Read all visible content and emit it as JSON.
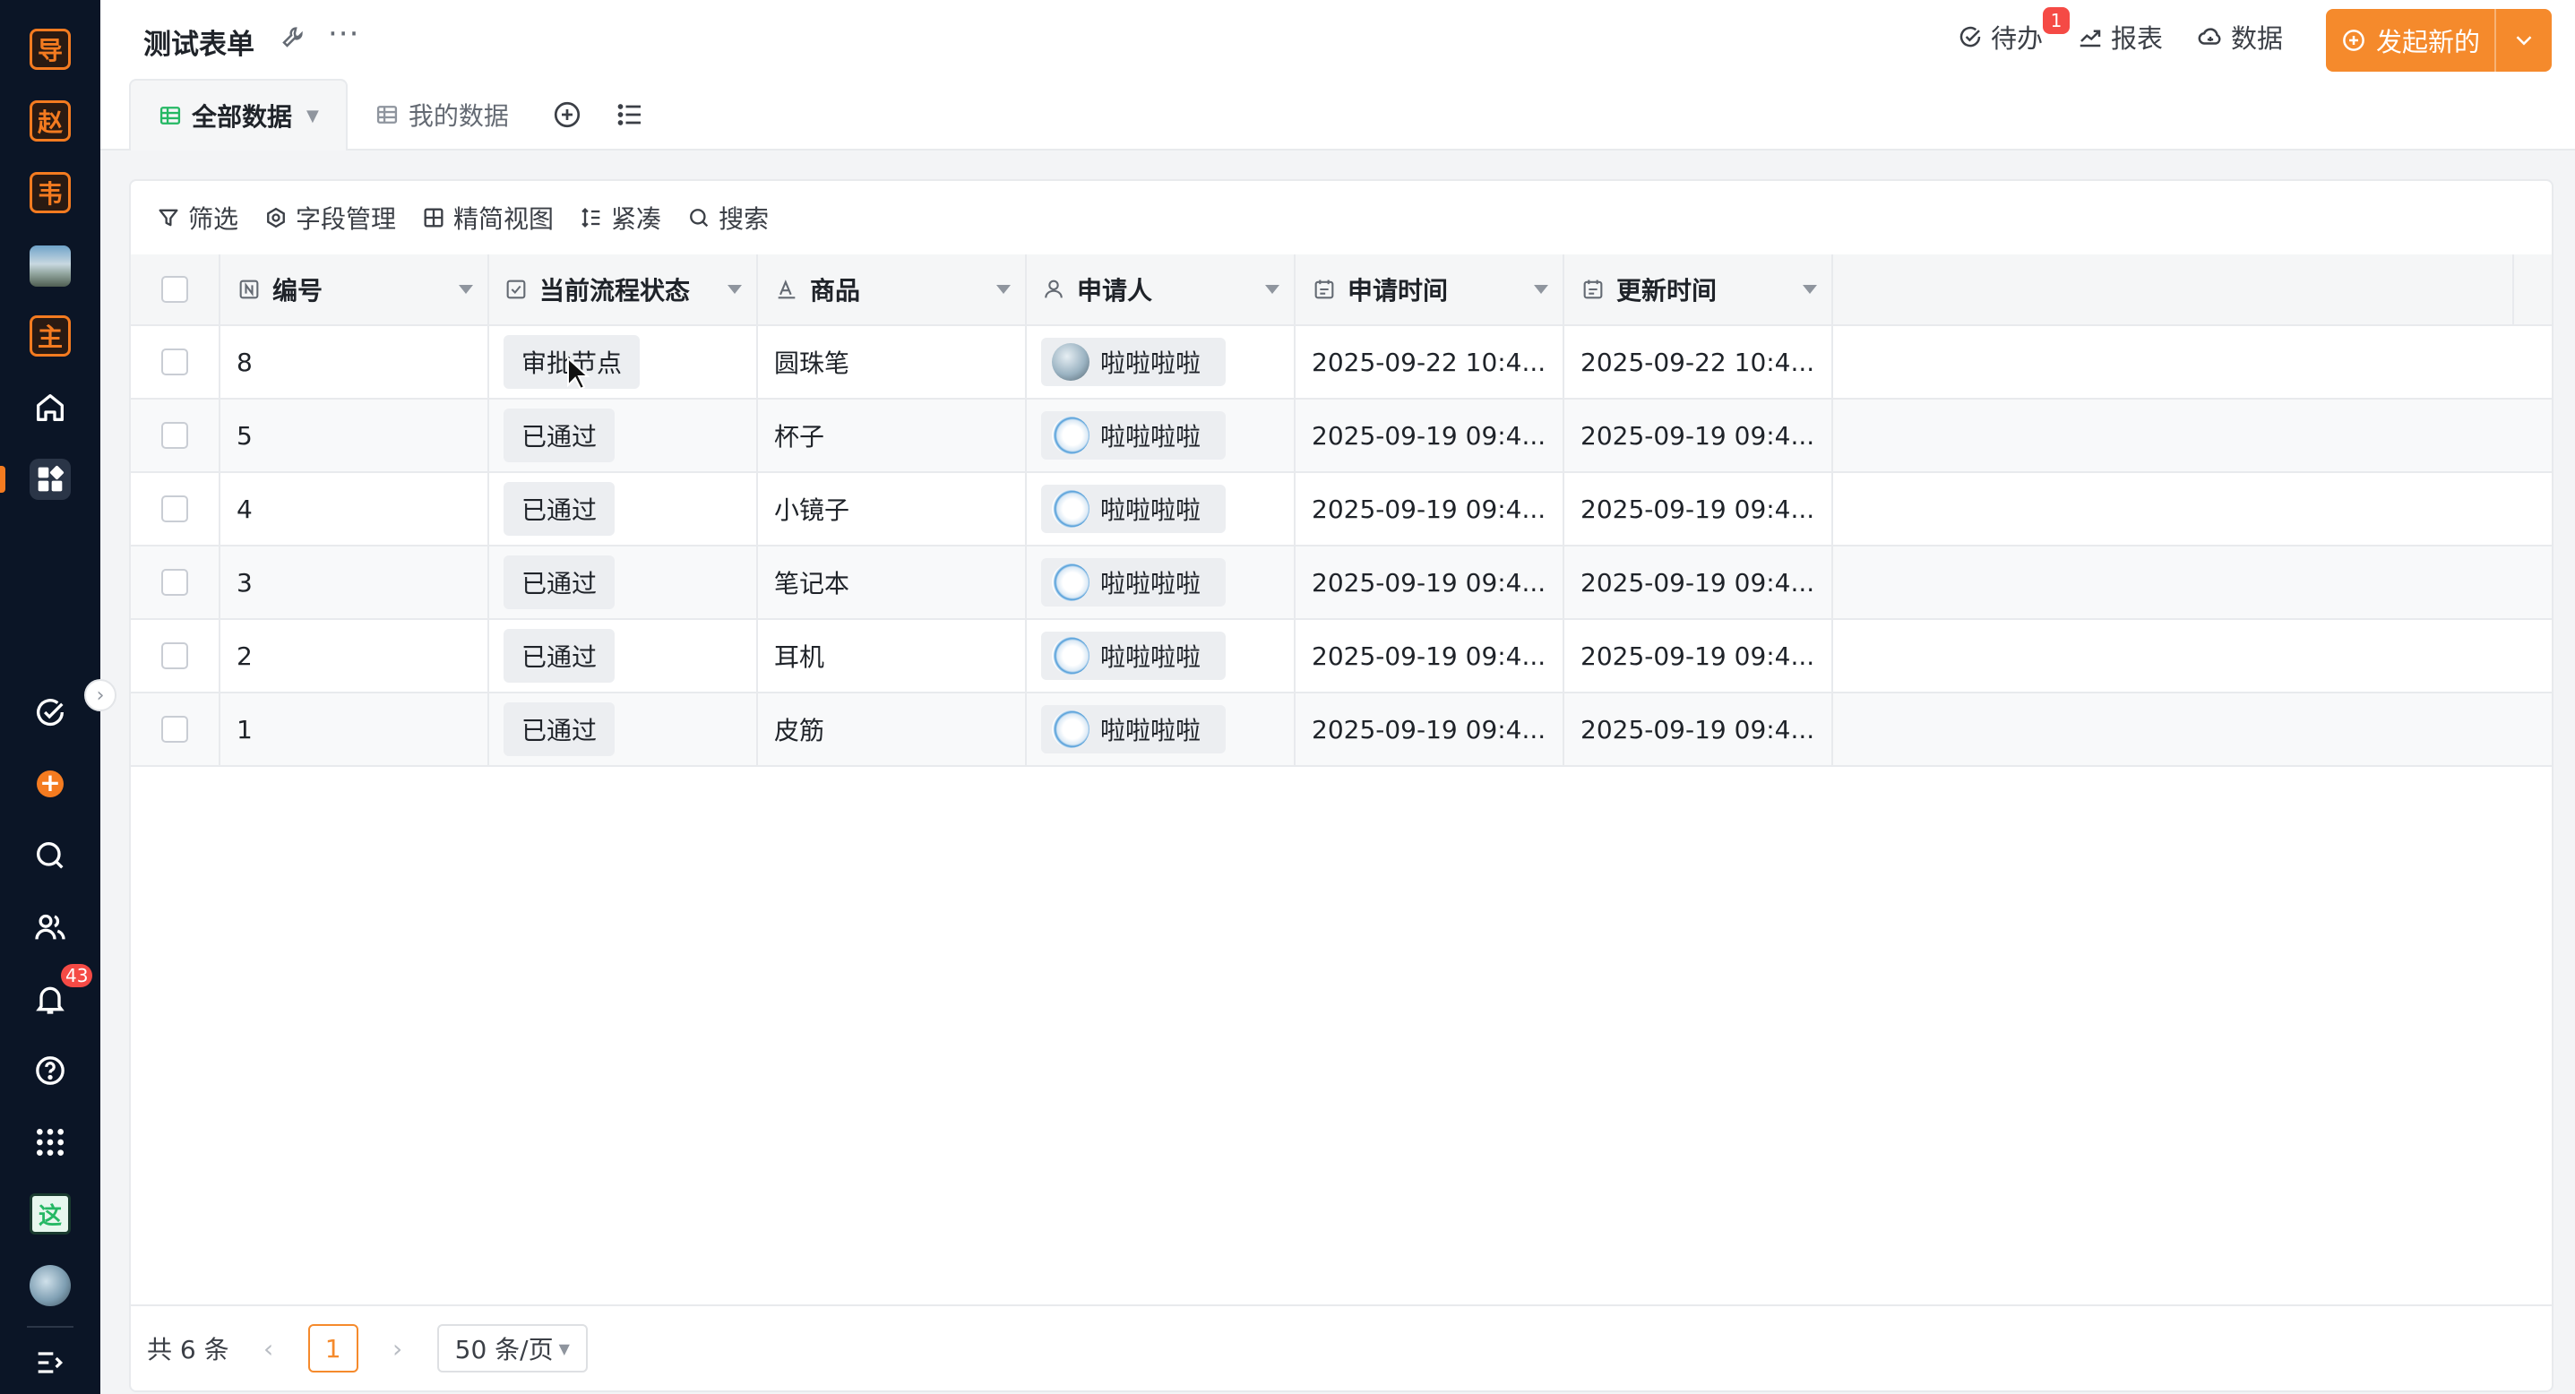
{
  "sidebar": {
    "apps": [
      {
        "char": "导"
      },
      {
        "char": "赵"
      },
      {
        "char": "韦"
      },
      {
        "char": "主"
      }
    ],
    "notification_count": "43",
    "green_app_char": "这",
    "add_char": "+"
  },
  "header": {
    "title": "测试表单",
    "more": "···",
    "todo_label": "待办",
    "todo_badge": "1",
    "report_label": "报表",
    "data_label": "数据",
    "start_label": "发起新的"
  },
  "tabs": [
    {
      "label": "全部数据"
    },
    {
      "label": "我的数据"
    }
  ],
  "toolbar": {
    "filter": "筛选",
    "fields": "字段管理",
    "simple_view": "精简视图",
    "compact": "紧凑",
    "search": "搜索"
  },
  "table": {
    "columns": [
      "编号",
      "当前流程状态",
      "商品",
      "申请人",
      "申请时间",
      "更新时间"
    ],
    "rows": [
      {
        "id": "8",
        "status": "审批节点",
        "product": "圆珠笔",
        "applicant": "啦啦啦啦",
        "applied": "2025-09-22 10:4...",
        "updated": "2025-09-22 10:4..."
      },
      {
        "id": "5",
        "status": "已通过",
        "product": "杯子",
        "applicant": "啦啦啦啦",
        "applied": "2025-09-19 09:4...",
        "updated": "2025-09-19 09:4..."
      },
      {
        "id": "4",
        "status": "已通过",
        "product": "小镜子",
        "applicant": "啦啦啦啦",
        "applied": "2025-09-19 09:4...",
        "updated": "2025-09-19 09:4..."
      },
      {
        "id": "3",
        "status": "已通过",
        "product": "笔记本",
        "applicant": "啦啦啦啦",
        "applied": "2025-09-19 09:4...",
        "updated": "2025-09-19 09:4..."
      },
      {
        "id": "2",
        "status": "已通过",
        "product": "耳机",
        "applicant": "啦啦啦啦",
        "applied": "2025-09-19 09:4...",
        "updated": "2025-09-19 09:4..."
      },
      {
        "id": "1",
        "status": "已通过",
        "product": "皮筋",
        "applicant": "啦啦啦啦",
        "applied": "2025-09-19 09:4...",
        "updated": "2025-09-19 09:4..."
      }
    ]
  },
  "pager": {
    "total": "共 6 条",
    "current_page": "1",
    "page_size": "50 条/页"
  },
  "colors": {
    "accent": "#f58a2c",
    "sidebar_bg": "#0b1526",
    "badge_red": "#f54a45"
  }
}
